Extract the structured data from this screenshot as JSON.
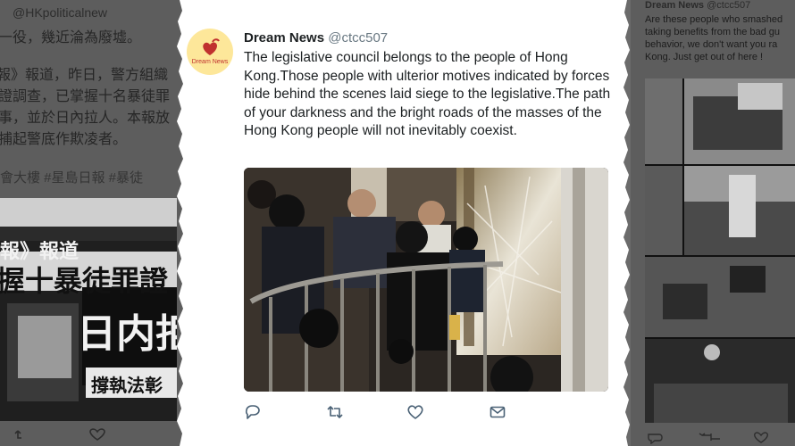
{
  "left_tweet": {
    "handle_fragment": "@HKpoliticalnew",
    "lines": [
      "一役，幾近淪為廢墟。",
      "報》報道，昨日，警方組織",
      "證調查，已掌握十名暴徒罪",
      "事，並於日內拉人。本報放",
      "捕起警底作欺凌者。"
    ],
    "hashtags": "會大樓 #星島日報 #暴徒",
    "image_caption_1": "報》報道",
    "image_caption_2": "握十暴徒罪證",
    "image_caption_3": "日内拒",
    "image_caption_4": "撐執法彰"
  },
  "right_tweet": {
    "display_name": "Dream News",
    "handle": "@ctcc507",
    "text": "Are these people who smashed taking benefits from the bad gu behavior, we don't want you ra Kong. Just get out of here !"
  },
  "main_tweet": {
    "avatar_text": "Dream News",
    "display_name": "Dream News",
    "handle": "@ctcc507",
    "text": "The legislative council belongs to the people of Hong Kong.Those people with ulterior motives indicated by forces hide behind the scenes laid siege to the legislative.The path of your darkness and the bright roads of the masses of the Hong Kong people will not inevitably coexist."
  },
  "icons": {
    "reply": "reply-icon",
    "retweet": "retweet-icon",
    "like": "heart-icon",
    "message": "envelope-icon"
  },
  "colors": {
    "action_icon": "#4a6175",
    "avatar_bg": "#fde79a",
    "avatar_accent": "#c0312f"
  }
}
